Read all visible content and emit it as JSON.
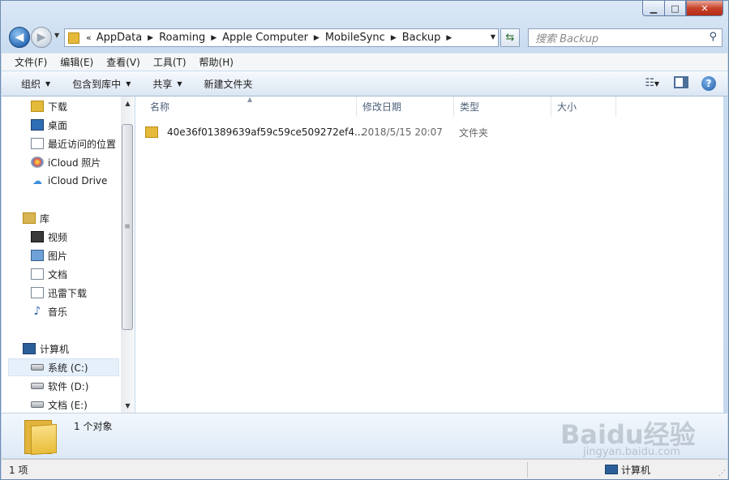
{
  "window": {
    "controls": {
      "minimize": "▁",
      "maximize": "□",
      "close": "✕"
    }
  },
  "navigation": {
    "back_icon": "back-arrow-icon",
    "forward_icon": "forward-arrow-icon",
    "breadcrumbs": [
      "AppData",
      "Roaming",
      "Apple Computer",
      "MobileSync",
      "Backup"
    ],
    "overflow": "«",
    "search_placeholder": "搜索 Backup"
  },
  "menu": [
    "文件(F)",
    "编辑(E)",
    "查看(V)",
    "工具(T)",
    "帮助(H)"
  ],
  "toolbar": {
    "organize": "组织",
    "include_in_library": "包含到库中",
    "share": "共享",
    "new_folder": "新建文件夹"
  },
  "nav_tree": {
    "favorites": [
      {
        "label": "下载",
        "icon": "download-folder-icon"
      },
      {
        "label": "桌面",
        "icon": "desktop-icon"
      },
      {
        "label": "最近访问的位置",
        "icon": "recent-places-icon"
      },
      {
        "label": "iCloud 照片",
        "icon": "icloud-photos-icon"
      },
      {
        "label": "iCloud Drive",
        "icon": "icloud-drive-icon"
      }
    ],
    "libraries_label": "库",
    "libraries": [
      {
        "label": "视频",
        "icon": "video-library-icon"
      },
      {
        "label": "图片",
        "icon": "pictures-library-icon"
      },
      {
        "label": "文档",
        "icon": "documents-library-icon"
      },
      {
        "label": "迅雷下载",
        "icon": "thunder-download-icon"
      },
      {
        "label": "音乐",
        "icon": "music-library-icon"
      }
    ],
    "computer_label": "计算机",
    "drives": [
      {
        "label": "系统 (C:)",
        "icon": "system-drive-icon"
      },
      {
        "label": "软件 (D:)",
        "icon": "drive-icon"
      },
      {
        "label": "文档 (E:)",
        "icon": "drive-icon"
      }
    ]
  },
  "file_list": {
    "columns": [
      "名称",
      "修改日期",
      "类型",
      "大小"
    ],
    "rows": [
      {
        "name": "40e36f01389639af59c59ce509272ef4...",
        "modified": "2018/5/15 20:07",
        "type": "文件夹",
        "size": ""
      }
    ]
  },
  "details": {
    "summary": "1 个对象"
  },
  "status": {
    "item_count": "1 项",
    "location": "计算机"
  },
  "watermark": {
    "brand": "Baidu经验",
    "url": "jingyan.baidu.com"
  }
}
